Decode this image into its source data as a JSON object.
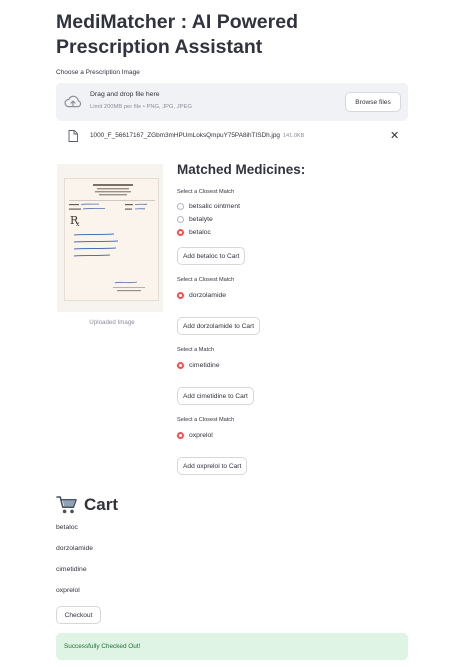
{
  "app": {
    "title": "MediMatcher : AI Powered Prescription Assistant"
  },
  "uploader": {
    "label": "Choose a Prescription Image",
    "drop_title": "Drag and drop file here",
    "drop_subtitle": "Limit 200MB per file • PNG, JPG, JPEG",
    "browse_label": "Browse files",
    "file_name": "1000_F_56617167_ZGbm3mHPUmLoksQmpuY75PA8ihTISDh.jpg",
    "file_size": "141.0KB",
    "close_glyph": "✕"
  },
  "preview": {
    "caption": "Uploaded Image"
  },
  "matched": {
    "heading": "Matched Medicines:",
    "groups": [
      {
        "label": "Select a Closest Match",
        "options": [
          "betsalic ointment",
          "betalyte",
          "betaloc"
        ],
        "selected": "betaloc",
        "button": "Add betaloc to Cart"
      },
      {
        "label": "Select a Closest Match",
        "options": [
          "dorzolamide"
        ],
        "selected": "dorzolamide",
        "button": "Add dorzolamide to Cart"
      },
      {
        "label": "Select a Match",
        "options": [
          "cimetidine"
        ],
        "selected": "cimetidine",
        "button": "Add cimetidine to Cart"
      },
      {
        "label": "Select a Closest Match",
        "options": [
          "oxprelol"
        ],
        "selected": "oxprelol",
        "button": "Add oxprelol to Cart"
      }
    ]
  },
  "cart": {
    "title": "Cart",
    "icon": "shopping-cart-icon",
    "items": [
      "betaloc",
      "dorzolamide",
      "cimetidine",
      "oxprelol"
    ],
    "checkout_label": "Checkout",
    "success_message": "Successfully Checked Out!"
  },
  "colors": {
    "accent": "#ff4b4b",
    "text": "#31333f",
    "muted": "#8c8f99",
    "dropzone_bg": "#f0f2f6",
    "success_bg": "#dff4e4",
    "success_text": "#177233"
  }
}
